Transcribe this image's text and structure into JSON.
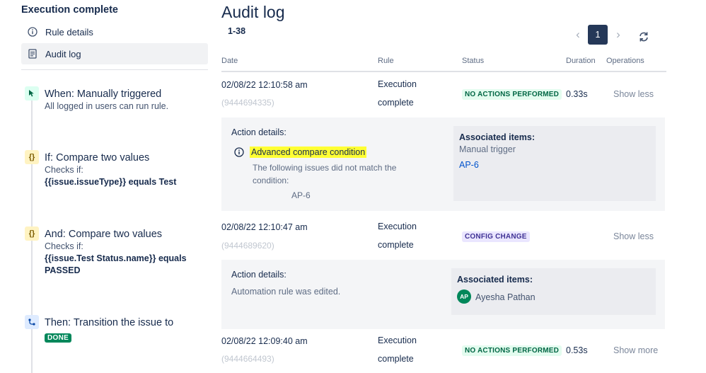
{
  "sidebar": {
    "title": "Execution complete",
    "nav": [
      {
        "label": "Rule details",
        "icon": "info-icon"
      },
      {
        "label": "Audit log",
        "icon": "document-icon",
        "active": true
      }
    ],
    "components": [
      {
        "icon": "cursor-icon",
        "title": "When: Manually triggered",
        "lines": [
          "All logged in users can run rule."
        ],
        "bold_lines": []
      },
      {
        "icon": "braces-icon",
        "title": "If: Compare two values",
        "lines": [
          "Checks if:"
        ],
        "bold_lines": [
          "{{issue.issueType}} equals Test"
        ]
      },
      {
        "icon": "braces-icon",
        "title": "And: Compare two values",
        "lines": [
          "Checks if:"
        ],
        "bold_lines": [
          "{{issue.Test Status.name}} equals",
          "PASSED"
        ]
      },
      {
        "icon": "transition-icon",
        "title": "Then: Transition the issue to",
        "lozenge": "DONE"
      }
    ]
  },
  "main": {
    "title": "Audit log",
    "range": "1-38",
    "pagination": {
      "current": "1",
      "prev_icon": "chevron-left-icon",
      "next_icon": "chevron-right-icon"
    },
    "refresh_icon": "refresh-icon",
    "columns": [
      "Date",
      "Rule",
      "Status",
      "Duration",
      "Operations"
    ],
    "rows": [
      {
        "date": "02/08/22 12:10:58 am",
        "id": "(9444694335)",
        "rule": [
          "Execution",
          "complete"
        ],
        "status": "NO ACTIONS PERFORMED",
        "status_color": "#006644",
        "duration": "0.33s",
        "operation": "Show less",
        "details": {
          "title": "Action details:",
          "item_title": "Advanced compare condition",
          "item_lines": [
            "The following issues did not match the",
            "condition:"
          ],
          "item_issue": "AP-6",
          "assoc_title": "Associated items:",
          "assoc_sub": "Manual trigger",
          "assoc_link": "AP-6"
        }
      },
      {
        "date": "02/08/22 12:10:47 am",
        "id": "(9444689620)",
        "rule": [
          "Execution",
          "complete"
        ],
        "status": "CONFIG CHANGE",
        "status_color": "#403294",
        "duration": "",
        "operation": "Show less",
        "details": {
          "title": "Action details:",
          "text": "Automation rule was edited.",
          "assoc_title": "Associated items:",
          "avatar": "AP",
          "user": "Ayesha Pathan"
        }
      },
      {
        "date": "02/08/22 12:09:40 am",
        "id": "(9444664493)",
        "rule": [
          "Execution",
          "complete"
        ],
        "status": "NO ACTIONS PERFORMED",
        "status_color": "#006644",
        "duration": "0.53s",
        "operation": "Show more"
      }
    ]
  }
}
